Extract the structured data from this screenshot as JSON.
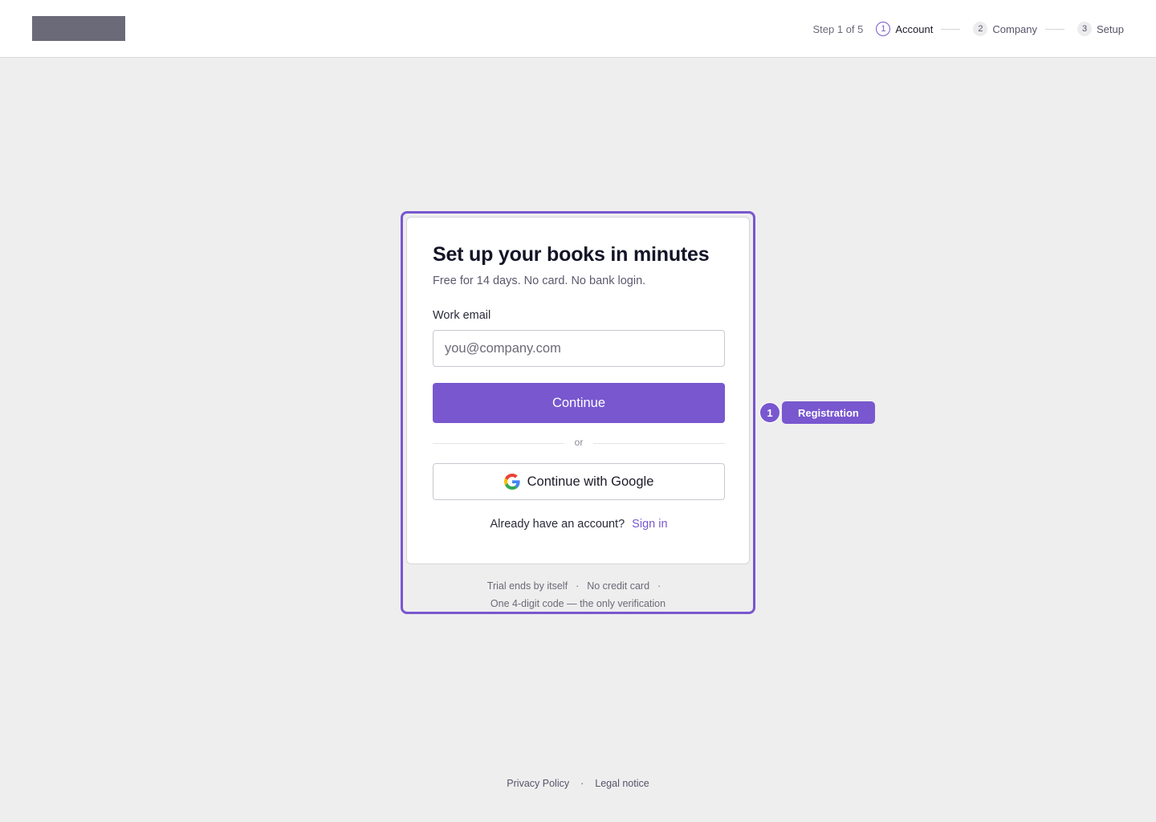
{
  "header": {
    "step_count": "Step 1 of 5",
    "steps": [
      {
        "num": "1",
        "label": "Account",
        "active": true
      },
      {
        "num": "2",
        "label": "Company",
        "active": false
      },
      {
        "num": "3",
        "label": "Setup",
        "active": false
      }
    ]
  },
  "card": {
    "title": "Set up your books in minutes",
    "subtitle": "Free for 14 days. No card. No bank login.",
    "email_label": "Work email",
    "email_placeholder": "you@company.com",
    "email_value": "",
    "continue_label": "Continue",
    "divider_text": "or",
    "google_label": "Continue with Google",
    "signin_prompt": "Already have an account?",
    "signin_link": "Sign in"
  },
  "trial_notes": {
    "note1": "Trial ends by itself",
    "note2": "No credit card",
    "note3": "One 4-digit code — the only verification",
    "separator": "·"
  },
  "callout": {
    "number": "1",
    "label": "Registration"
  },
  "footer": {
    "privacy": "Privacy Policy",
    "legal": "Legal notice",
    "separator": "·"
  },
  "colors": {
    "accent": "#7857cf",
    "background": "#eeeeee",
    "card": "#ffffff"
  },
  "icons": {
    "google": "google-g-icon"
  }
}
